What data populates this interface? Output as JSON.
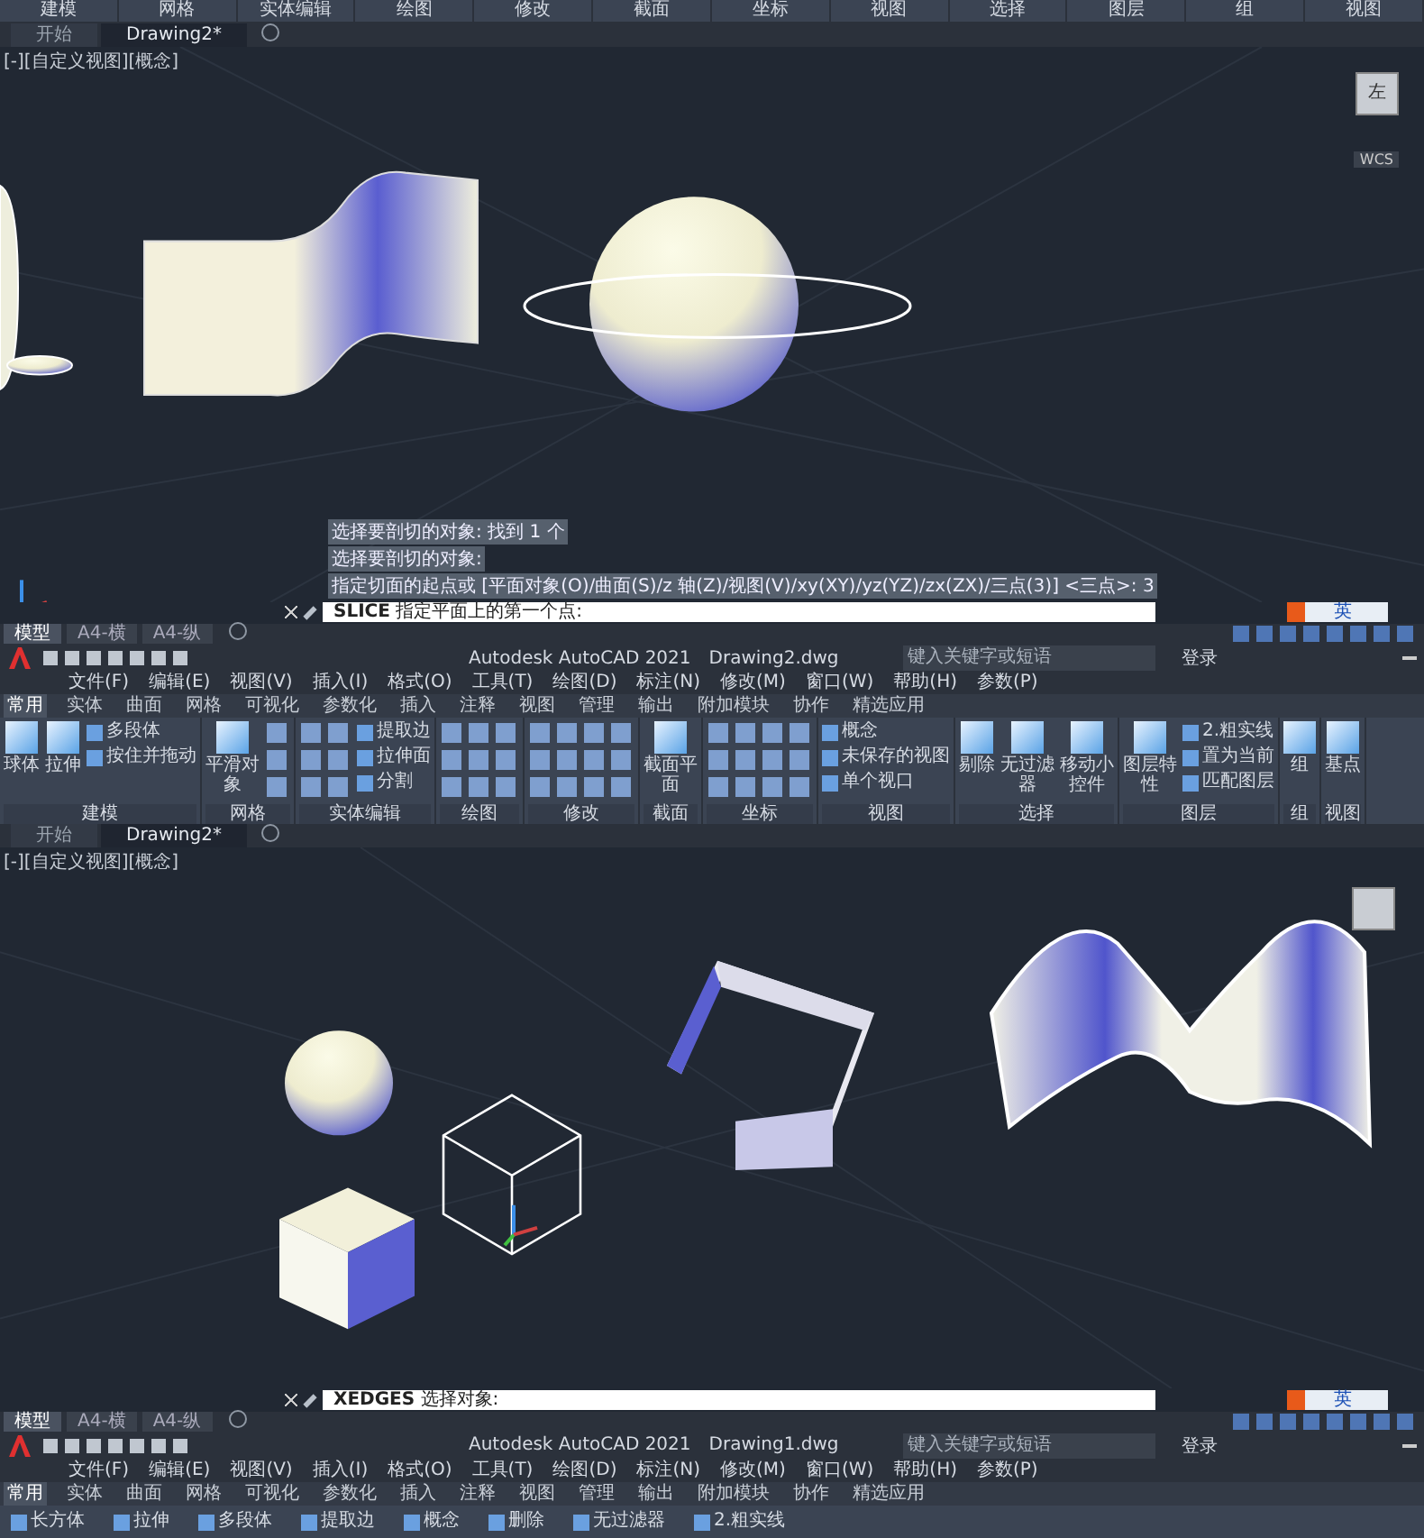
{
  "top_panel_titles": [
    "建模",
    "网格",
    "实体编辑",
    "绘图",
    "修改",
    "截面",
    "坐标",
    "视图",
    "选择",
    "图层",
    "组",
    "视图"
  ],
  "drawing_1": {
    "doc_tabs": [
      {
        "label": "开始",
        "selected": false
      },
      {
        "label": "Drawing2*",
        "selected": true
      }
    ],
    "viewport_label": "[-][自定义视图][概念]",
    "viewcube_face": "左",
    "viewcube_ucs": "WCS",
    "command_history": [
      "选择要剖切的对象: 找到 1 个",
      "选择要剖切的对象:",
      "指定切面的起点或 [平面对象(O)/曲面(S)/z 轴(Z)/视图(V)/xy(XY)/yz(YZ)/zx(ZX)/三点(3)] <三点>: 3"
    ],
    "command": {
      "name": "SLICE",
      "prompt": "指定平面上的第一个点:"
    },
    "ime_label": "英"
  },
  "app_bar_1": {
    "layout_tabs": [
      {
        "label": "模型",
        "selected": true
      },
      {
        "label": "A4-横",
        "selected": false
      },
      {
        "label": "A4-纵",
        "selected": false
      }
    ],
    "title": "Autodesk AutoCAD 2021",
    "file": "Drawing2.dwg",
    "search": {
      "placeholder": "键入关键字或短语"
    },
    "login": "登录",
    "menu": [
      "文件(F)",
      "编辑(E)",
      "视图(V)",
      "插入(I)",
      "格式(O)",
      "工具(T)",
      "绘图(D)",
      "标注(N)",
      "修改(M)",
      "窗口(W)",
      "帮助(H)",
      "参数(P)"
    ],
    "ribbon_tabs": [
      {
        "label": "常用",
        "selected": true
      },
      {
        "label": "实体",
        "selected": false
      },
      {
        "label": "曲面",
        "selected": false
      },
      {
        "label": "网格",
        "selected": false
      },
      {
        "label": "可视化",
        "selected": false
      },
      {
        "label": "参数化",
        "selected": false
      },
      {
        "label": "插入",
        "selected": false
      },
      {
        "label": "注释",
        "selected": false
      },
      {
        "label": "视图",
        "selected": false
      },
      {
        "label": "管理",
        "selected": false
      },
      {
        "label": "输出",
        "selected": false
      },
      {
        "label": "附加模块",
        "selected": false
      },
      {
        "label": "协作",
        "selected": false
      },
      {
        "label": "精选应用",
        "selected": false
      }
    ],
    "panels": [
      {
        "title": "建模",
        "big": [
          "球体",
          "拉伸"
        ],
        "small": [
          "多段体",
          "按住并拖动"
        ]
      },
      {
        "title": "网格",
        "big": [
          "平滑对象"
        ]
      },
      {
        "title": "实体编辑",
        "small": [
          "提取边",
          "拉伸面",
          "分割"
        ]
      },
      {
        "title": "绘图"
      },
      {
        "title": "修改"
      },
      {
        "title": "截面",
        "big": [
          "截面平面"
        ]
      },
      {
        "title": "坐标"
      },
      {
        "title": "视图",
        "small": [
          "概念",
          "未保存的视图",
          "单个视口"
        ]
      },
      {
        "title": "选择",
        "big": [
          "剔除",
          "无过滤器",
          "移动小控件"
        ]
      },
      {
        "title": "图层",
        "big": [
          "图层特性"
        ],
        "small": [
          "2.粗实线",
          "置为当前",
          "匹配图层"
        ]
      },
      {
        "title": "组",
        "big": [
          "组"
        ]
      },
      {
        "title": "视图",
        "big": [
          "基点"
        ]
      }
    ]
  },
  "drawing_2": {
    "doc_tabs": [
      {
        "label": "开始",
        "selected": false
      },
      {
        "label": "Drawing2*",
        "selected": true
      }
    ],
    "viewport_label": "[-][自定义视图][概念]",
    "command": {
      "name": "XEDGES",
      "prompt": "选择对象:"
    },
    "ime_label": "英"
  },
  "app_bar_2": {
    "layout_tabs": [
      {
        "label": "模型",
        "selected": true
      },
      {
        "label": "A4-横",
        "selected": false
      },
      {
        "label": "A4-纵",
        "selected": false
      }
    ],
    "title": "Autodesk AutoCAD 2021",
    "file": "Drawing1.dwg",
    "search": {
      "placeholder": "键入关键字或短语"
    },
    "login": "登录",
    "menu": [
      "文件(F)",
      "编辑(E)",
      "视图(V)",
      "插入(I)",
      "格式(O)",
      "工具(T)",
      "绘图(D)",
      "标注(N)",
      "修改(M)",
      "窗口(W)",
      "帮助(H)",
      "参数(P)"
    ],
    "ribbon_tabs": [
      {
        "label": "常用",
        "selected": true
      },
      {
        "label": "实体",
        "selected": false
      },
      {
        "label": "曲面",
        "selected": false
      },
      {
        "label": "网格",
        "selected": false
      },
      {
        "label": "可视化",
        "selected": false
      },
      {
        "label": "参数化",
        "selected": false
      },
      {
        "label": "插入",
        "selected": false
      },
      {
        "label": "注释",
        "selected": false
      },
      {
        "label": "视图",
        "selected": false
      },
      {
        "label": "管理",
        "selected": false
      },
      {
        "label": "输出",
        "selected": false
      },
      {
        "label": "附加模块",
        "selected": false
      },
      {
        "label": "协作",
        "selected": false
      },
      {
        "label": "精选应用",
        "selected": false
      }
    ],
    "ribbon_items": [
      "长方体",
      "拉伸",
      "多段体",
      "提取边",
      "概念",
      "删除",
      "无过滤器",
      "2.粗实线"
    ]
  }
}
